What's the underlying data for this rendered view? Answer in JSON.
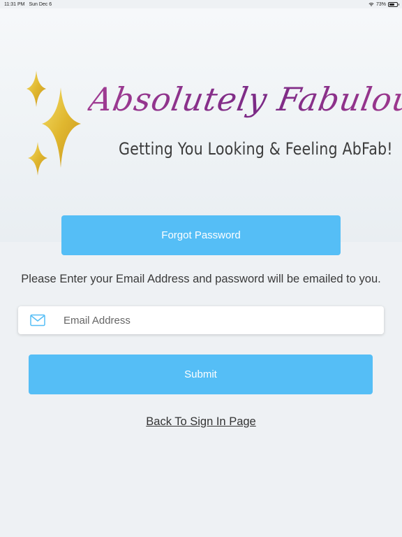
{
  "status_bar": {
    "time": "11:31 PM",
    "date": "Sun Dec 6",
    "battery": "73%",
    "battery_level": 0.73,
    "wifi_icon": "wifi-icon",
    "battery_icon": "battery-icon"
  },
  "logo": {
    "title": "Absolutely Fabulous",
    "tagline": "Getting You Looking & Feeling AbFab!",
    "colors": {
      "title": "#8a2c84",
      "sparkle": "#e8c540"
    }
  },
  "forgot_password": {
    "label": "Forgot Password"
  },
  "instruction": "Please Enter your Email Address and password will be emailed to you.",
  "email": {
    "placeholder": "Email Address",
    "value": "",
    "icon": "mail-icon"
  },
  "submit": {
    "label": "Submit"
  },
  "back_link": {
    "label": "Back To Sign In Page"
  },
  "colors": {
    "button": "#55bef6",
    "background": "#eef1f4",
    "mail_icon": "#55bef6"
  }
}
